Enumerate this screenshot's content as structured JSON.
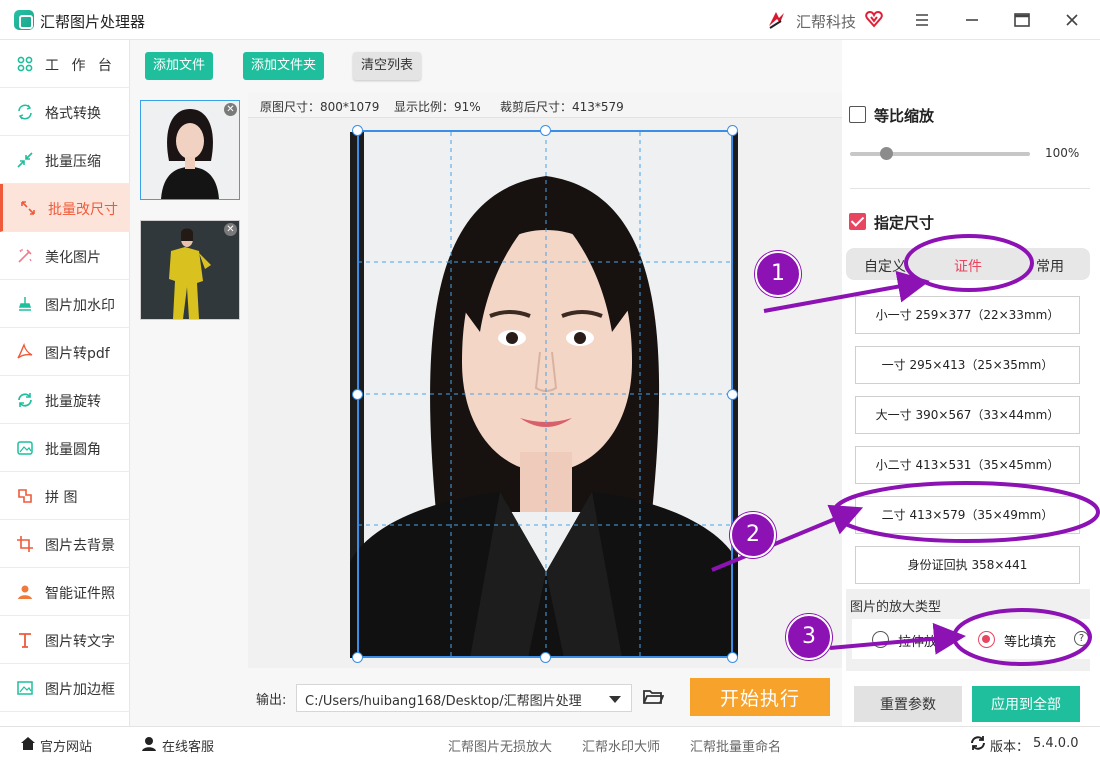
{
  "app": {
    "title": "汇帮图片处理器",
    "brand": "汇帮科技"
  },
  "sidebar": {
    "items": [
      {
        "label": "工 作 台",
        "icon": "grid-icon"
      },
      {
        "label": "格式转换",
        "icon": "convert-icon"
      },
      {
        "label": "批量压缩",
        "icon": "compress-icon"
      },
      {
        "label": "批量改尺寸",
        "icon": "resize-icon",
        "active": true
      },
      {
        "label": "美化图片",
        "icon": "beautify-icon"
      },
      {
        "label": "图片加水印",
        "icon": "watermark-icon"
      },
      {
        "label": "图片转pdf",
        "icon": "pdf-icon"
      },
      {
        "label": "批量旋转",
        "icon": "rotate-icon"
      },
      {
        "label": "批量圆角",
        "icon": "round-corner-icon"
      },
      {
        "label": "拼    图",
        "icon": "puzzle-icon"
      },
      {
        "label": "图片去背景",
        "icon": "crop-icon"
      },
      {
        "label": "智能证件照",
        "icon": "person-icon"
      },
      {
        "label": "图片转文字",
        "icon": "text-icon"
      },
      {
        "label": "图片加边框",
        "icon": "frame-icon"
      }
    ]
  },
  "toolbar": {
    "add_file": "添加文件",
    "add_folder": "添加文件夹",
    "clear_list": "清空列表"
  },
  "preview": {
    "original_size": "原图尺寸：800*1079",
    "display_ratio": "显示比例：91%",
    "cropped_size": "裁剪后尺寸：413*579"
  },
  "output": {
    "label": "输出:",
    "path": "C:/Users/huibang168/Desktop/汇帮图片处理",
    "start": "开始执行"
  },
  "right_panel": {
    "proportional_scale": "等比缩放",
    "scale_value": "100%",
    "scale_level": 0.2,
    "specify_size": "指定尺寸",
    "tabs": [
      "自定义",
      "证件",
      "常用"
    ],
    "active_tab": "证件",
    "sizes": [
      "小一寸 259×377（22×33mm）",
      "一寸 295×413（25×35mm）",
      "大一寸 390×567（33×44mm）",
      "小二寸 413×531（35×45mm）",
      "二寸 413×579（35×49mm）",
      "身份证回执 358×441"
    ],
    "enlarge_title": "图片的放大类型",
    "stretch": "拉伸放",
    "fill": "等比填充",
    "help": "?",
    "reset": "重置参数",
    "apply_all": "应用到全部"
  },
  "annotations": [
    "1",
    "2",
    "3"
  ],
  "statusbar": {
    "website": "官方网站",
    "service": "在线客服",
    "link1": "汇帮图片无损放大",
    "link2": "汇帮水印大师",
    "link3": "汇帮批量重命名",
    "version_label": "版本：",
    "version": "5.4.0.0"
  },
  "colors": {
    "accent": "#1fbf9d",
    "active": "#ef5a3a",
    "pink": "#e84561",
    "annotation": "#8c12b4",
    "start": "#f6a22b"
  }
}
